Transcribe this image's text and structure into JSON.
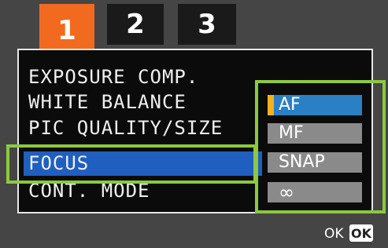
{
  "tabs": [
    {
      "label": "1",
      "active": true
    },
    {
      "label": "2",
      "active": false
    },
    {
      "label": "3",
      "active": false
    }
  ],
  "menu": {
    "items": [
      {
        "label": "EXPOSURE COMP."
      },
      {
        "label": "WHITE BALANCE"
      },
      {
        "label": "PIC QUALITY/SIZE"
      },
      {
        "label": "FOCUS",
        "selected": true
      },
      {
        "label": "CONT. MODE"
      }
    ]
  },
  "focus_options": {
    "items": [
      {
        "label": "AF",
        "selected": true
      },
      {
        "label": "MF"
      },
      {
        "label": "SNAP"
      },
      {
        "label": "∞"
      }
    ]
  },
  "footer": {
    "ok_text": "OK",
    "ok_key": "OK"
  },
  "colors": {
    "tab_active": "#f26a20",
    "tab_inactive": "#1a1a1a",
    "selection": "#1f5fbf",
    "option_selected": "#2b7fc4",
    "option": "#8a8a8a",
    "highlight_frame": "#8bc93f",
    "cursor": "#f2b21b"
  }
}
